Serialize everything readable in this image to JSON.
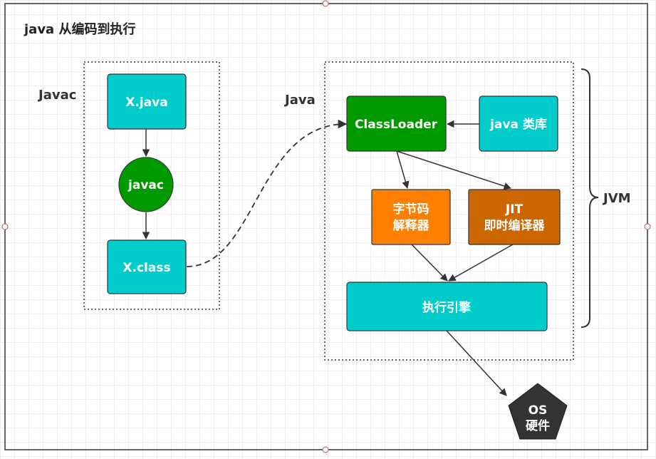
{
  "title": "java 从编码到执行",
  "labels": {
    "javac_group": "Javac",
    "java_group": "Java",
    "jvm": "JVM"
  },
  "nodes": {
    "xjava": "X.java",
    "javac": "javac",
    "xclass": "X.class",
    "classloader": "ClassLoader",
    "javalib": "java 类库",
    "bytecode_line1": "字节码",
    "bytecode_line2": "解释器",
    "jit_line1": "JIT",
    "jit_line2": "即时编译器",
    "engine": "执行引擎",
    "os_line1": "OS",
    "os_line2": "硬件"
  },
  "colors": {
    "teal": "#00CCCC",
    "green": "#009900",
    "orange": "#FF8000",
    "dark_orange": "#CC6600",
    "os_dark": "#333333"
  }
}
